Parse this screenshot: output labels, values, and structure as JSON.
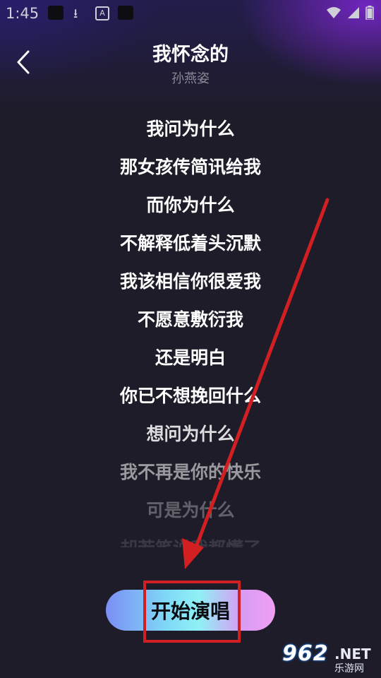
{
  "status_bar": {
    "time": "1:45",
    "icons": [
      "notification-square-icon",
      "download-icon",
      "a-icon",
      "notification-square-icon",
      "wifi-icon",
      "signal-icon",
      "battery-icon"
    ]
  },
  "header": {
    "title": "我怀念的",
    "artist": "孙燕姿",
    "back_icon": "chevron-left-icon"
  },
  "lyrics": [
    {
      "text": "我问为什么",
      "opacity": 1.0
    },
    {
      "text": "那女孩传简讯给我",
      "opacity": 1.0
    },
    {
      "text": "而你为什么",
      "opacity": 1.0
    },
    {
      "text": "不解释低着头沉默",
      "opacity": 1.0
    },
    {
      "text": "我该相信你很爱我",
      "opacity": 1.0
    },
    {
      "text": "不愿意敷衍我",
      "opacity": 1.0
    },
    {
      "text": "还是明白",
      "opacity": 1.0
    },
    {
      "text": "你已不想挽回什么",
      "opacity": 1.0
    },
    {
      "text": "想问为什么",
      "opacity": 0.85
    },
    {
      "text": "我不再是你的快乐",
      "opacity": 0.55
    },
    {
      "text": "可是为什么",
      "opacity": 0.3
    },
    {
      "text": "却若笑说我都懂了",
      "opacity": 0.12
    }
  ],
  "action": {
    "start_label": "开始演唱"
  },
  "watermark": {
    "number": "962",
    "domain": ".NET",
    "name": "乐游网"
  },
  "colors": {
    "annotation_red": "#d21f21",
    "background": "#1e1c28"
  }
}
